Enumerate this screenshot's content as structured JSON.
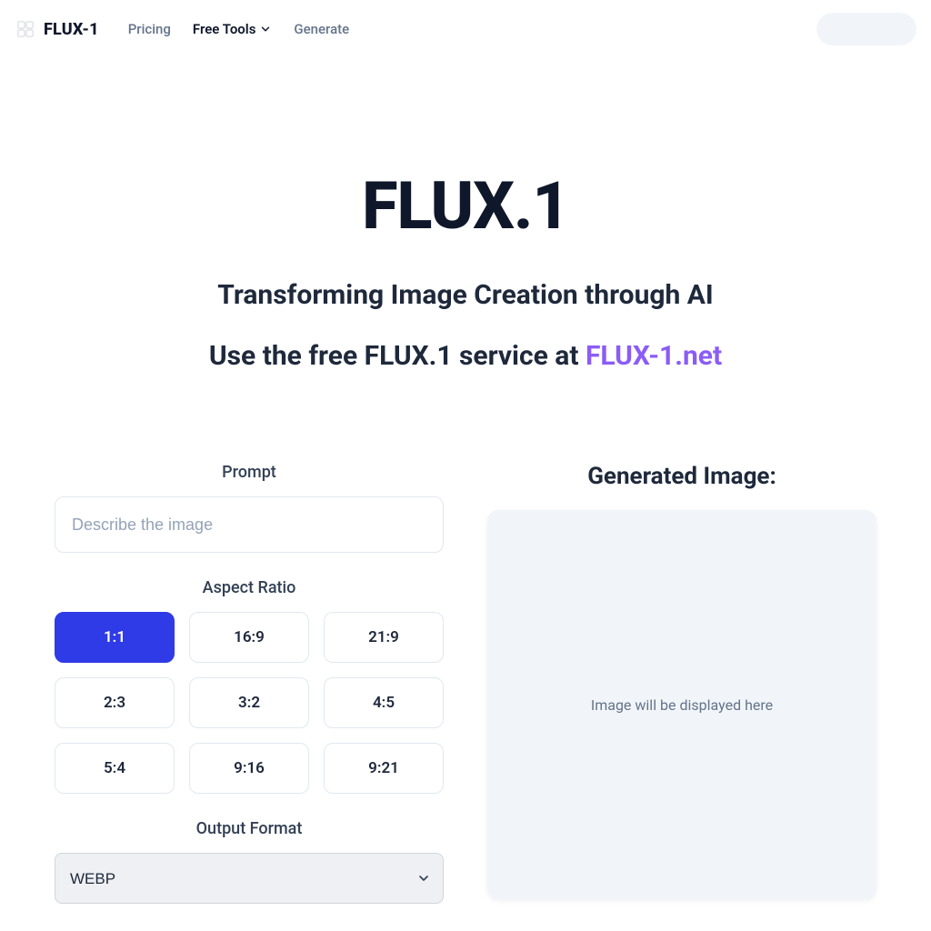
{
  "header": {
    "brand": "FLUX-1",
    "nav": {
      "pricing": "Pricing",
      "free_tools": "Free Tools",
      "generate": "Generate"
    }
  },
  "hero": {
    "title": "FLUX.1",
    "subtitle": "Transforming Image Creation through AI",
    "cta_prefix": "Use the free FLUX.1 service at ",
    "cta_link": "FLUX-1.net"
  },
  "form": {
    "prompt_label": "Prompt",
    "prompt_placeholder": "Describe the image",
    "aspect_label": "Aspect Ratio",
    "ratios": [
      "1:1",
      "16:9",
      "21:9",
      "2:3",
      "3:2",
      "4:5",
      "5:4",
      "9:16",
      "9:21"
    ],
    "selected_ratio": "1:1",
    "output_label": "Output Format",
    "output_option": "WEBP"
  },
  "output": {
    "title": "Generated Image:",
    "placeholder": "Image will be displayed here"
  }
}
